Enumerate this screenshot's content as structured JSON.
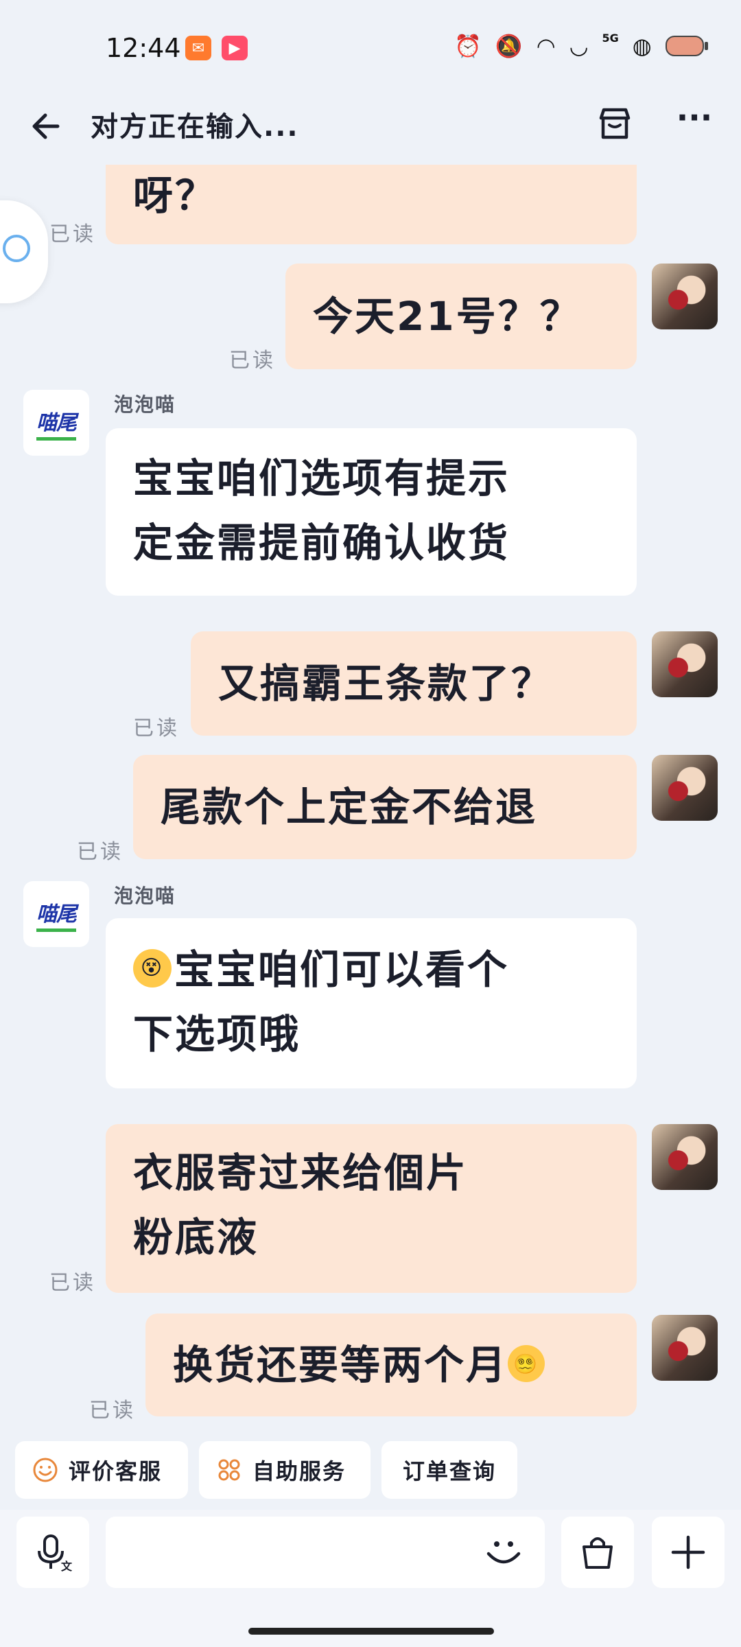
{
  "status": {
    "time": "12:44",
    "network": "5G"
  },
  "header": {
    "title": "对方正在输入..."
  },
  "messages": [
    {
      "text": "呀？",
      "read": "已读"
    },
    {
      "text": "今天21号？？",
      "read": "已读"
    },
    {
      "sender": "泡泡喵",
      "line1": "宝宝咱们选项有提示",
      "line2": "定金需提前确认收货"
    },
    {
      "text": "又搞霸王条款了？",
      "read": "已读"
    },
    {
      "text": "尾款个上定金不给退",
      "read": "已读"
    },
    {
      "sender": "泡泡喵",
      "line1": "宝宝咱们可以看个",
      "line2": "下选项哦"
    },
    {
      "line1": "衣服寄过来给個片",
      "line2": "粉底液",
      "read": "已读"
    },
    {
      "text": "换货还要等两个月",
      "read": "已读"
    }
  ],
  "shop": {
    "logo_text": "喵尾"
  },
  "quick_actions": [
    "评价客服",
    "自助服务",
    "订单查询"
  ],
  "colors": {
    "mine_bubble": "#fde6d6",
    "theirs_bubble": "#ffffff",
    "background": "#eef2f8"
  }
}
